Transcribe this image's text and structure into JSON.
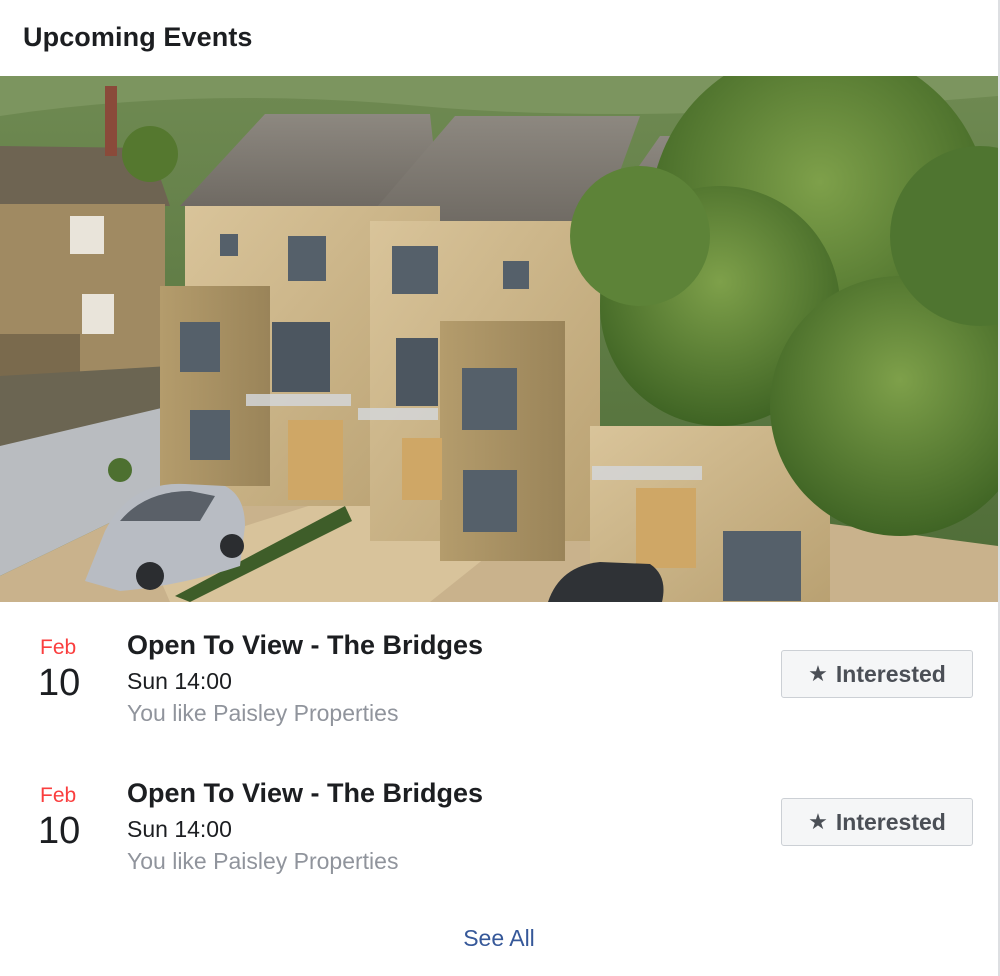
{
  "panel": {
    "title": "Upcoming Events"
  },
  "cover": {
    "icon": "event-cover-photo"
  },
  "events": [
    {
      "month": "Feb",
      "day": "10",
      "title": "Open To View - The Bridges",
      "time": "Sun 14:00",
      "social": "You like Paisley Properties",
      "action_icon": "star-icon",
      "action_label": "Interested"
    },
    {
      "month": "Feb",
      "day": "10",
      "title": "Open To View - The Bridges",
      "time": "Sun 14:00",
      "social": "You like Paisley Properties",
      "action_icon": "star-icon",
      "action_label": "Interested"
    }
  ],
  "footer": {
    "see_all_label": "See All"
  },
  "colors": {
    "month_accent": "#fa3e3e",
    "link": "#365899",
    "secondary_text": "#90949c",
    "button_bg": "#f5f6f7"
  }
}
